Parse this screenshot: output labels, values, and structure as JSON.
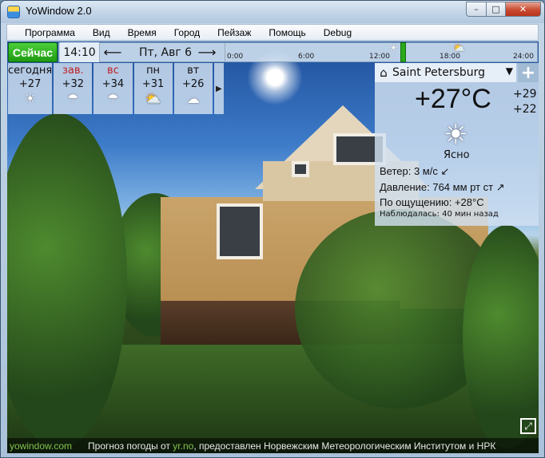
{
  "window": {
    "title": "YoWindow 2.0",
    "min": "–",
    "max": "□",
    "close": "✕"
  },
  "menu": [
    "Программа",
    "Вид",
    "Время",
    "Город",
    "Пейзаж",
    "Помощь",
    "Debug"
  ],
  "topbar": {
    "now_label": "Сейчас",
    "time": "14:10",
    "prev": "⟵",
    "next": "⟶",
    "date": "Пт, Авг 6",
    "timeline_labels": [
      "0:00",
      "6:00",
      "12:00",
      "18:00",
      "24:00"
    ],
    "timeline_icons": [
      "sun-icon",
      "partly-cloudy-icon"
    ]
  },
  "forecast": [
    {
      "name": "сегодня",
      "temp": "+27",
      "icon": "☀",
      "weekend": false
    },
    {
      "name": "зав.",
      "temp": "+32",
      "icon": "☂",
      "weekend": true
    },
    {
      "name": "вс",
      "temp": "+34",
      "icon": "☂",
      "weekend": true
    },
    {
      "name": "пн",
      "temp": "+31",
      "icon": "⛅",
      "weekend": false
    },
    {
      "name": "вт",
      "temp": "+26",
      "icon": "☁",
      "weekend": false
    }
  ],
  "forecast_next": "▶",
  "current": {
    "city": "Saint Petersburg",
    "dropdown": "▼",
    "add": "+",
    "home": "⌂",
    "temp": "+27°C",
    "high": "+29",
    "low": "+22",
    "icon": "☀",
    "desc": "Ясно",
    "wind": "Ветер:  3 м/с",
    "wind_dir": "↙",
    "pressure": "Давление:  764 мм рт ст",
    "pressure_dir": "↗",
    "feels": "По ощущению:  +28°C",
    "observed": "Наблюдалась:  40 мин назад"
  },
  "footer": {
    "site": "yowindow.com",
    "prefix": "Прогноз погоды от ",
    "yr": "yr.no",
    "suffix": ", предоставлен Норвежским Метеорологическим Институтом и НРК"
  },
  "fullscreen": "⤢"
}
